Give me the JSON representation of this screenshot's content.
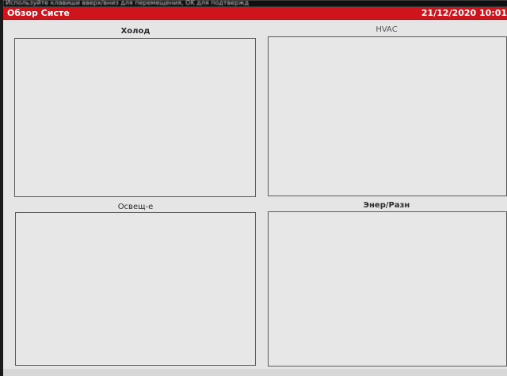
{
  "header": {
    "hint": "Используйте клавиши вверх/вниз для перемещения, OK для подтвержд",
    "title": "Обзор Систе",
    "datetime": "21/12/2020 10:01"
  },
  "panels": [
    {
      "label": "Холод"
    },
    {
      "label": "HVAC"
    },
    {
      "label": "Освещ-е"
    },
    {
      "label": "Энер/Разн"
    }
  ],
  "colors": {
    "title_bar": "#d0141c",
    "background": "#e4e5e4",
    "panel_border": "#5a5a5a"
  }
}
